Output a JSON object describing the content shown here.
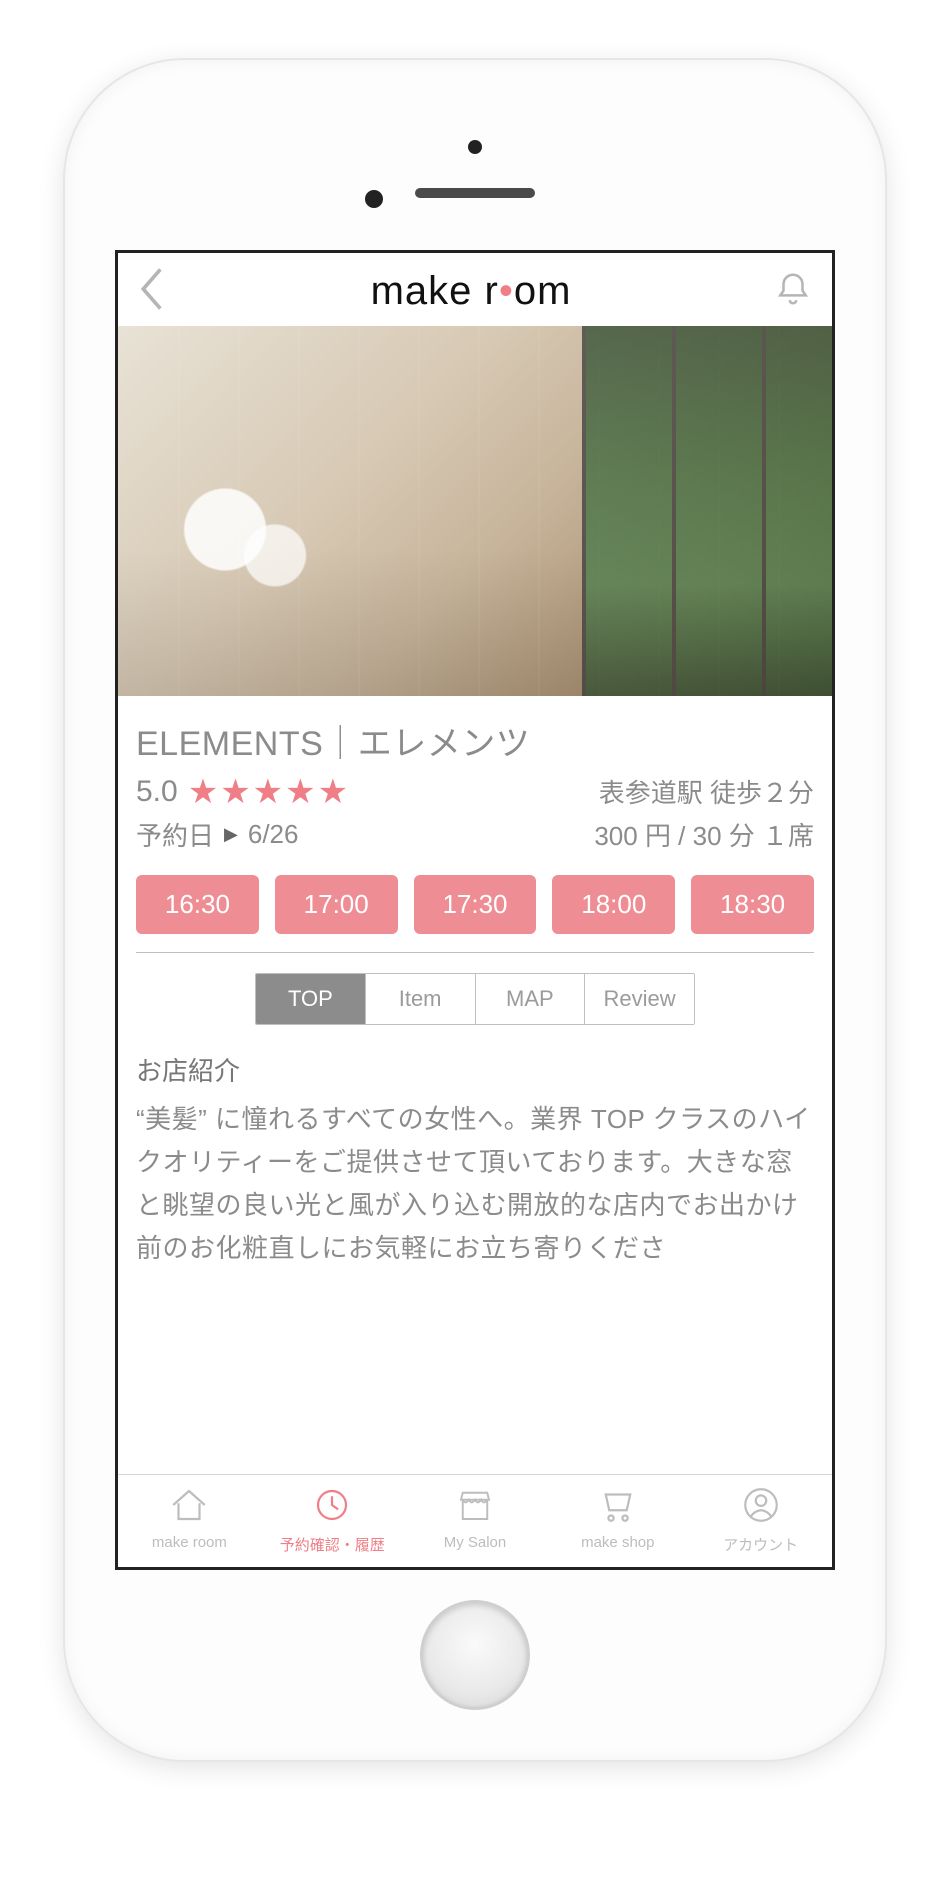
{
  "header": {
    "title_pre": "make r",
    "title_post": "om"
  },
  "salon": {
    "name": "ELEMENTS｜エレメンツ",
    "rating": "5.0",
    "station": "表参道駅 徒歩２分",
    "reserve_label": "予約日",
    "reserve_date": "6/26",
    "price": "300 円 / 30 分 １席"
  },
  "slots": [
    "16:30",
    "17:00",
    "17:30",
    "18:00",
    "18:30"
  ],
  "tabs": [
    {
      "label": "TOP",
      "active": true
    },
    {
      "label": "Item",
      "active": false
    },
    {
      "label": "MAP",
      "active": false
    },
    {
      "label": "Review",
      "active": false
    }
  ],
  "description": {
    "heading": "お店紹介",
    "body": "“美髪” に憧れるすべての女性へ。業界 TOP クラスのハイクオリティーをご提供させて頂いております。大きな窓と眺望の良い光と風が入り込む開放的な店内でお出かけ前のお化粧直しにお気軽にお立ち寄りくださ"
  },
  "bottom_nav": [
    {
      "label": "make room",
      "active": false
    },
    {
      "label": "予約確認・履歴",
      "active": true
    },
    {
      "label": "My Salon",
      "active": false
    },
    {
      "label": "make shop",
      "active": false
    },
    {
      "label": "アカウント",
      "active": false
    }
  ]
}
